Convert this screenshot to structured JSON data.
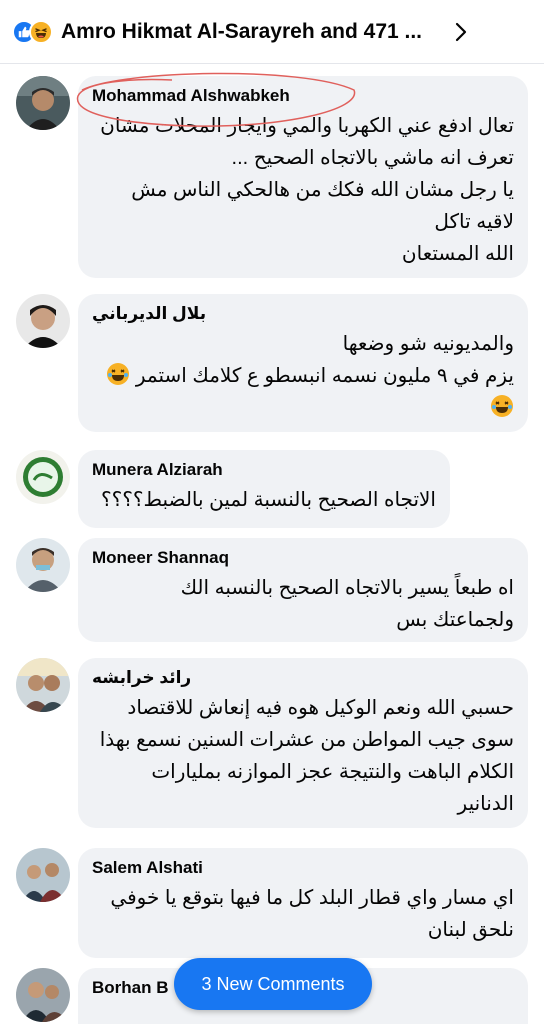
{
  "header": {
    "title": "Amro Hikmat Al-Sarayreh and 471 ...",
    "reactions": [
      "like-icon",
      "haha-icon"
    ]
  },
  "comments": [
    {
      "author": "Mohammad Alshwabkeh",
      "lines": [
        "تعال ادفع عني الكهربا والمي وايجار المحلات مشان",
        "تعرف انه ماشي بالاتجاه الصحيح ...",
        "يا رجل مشان الله فكك من هالحكي الناس مش",
        "لاقيه تاكل",
        "الله المستعان"
      ]
    },
    {
      "author": "بلال الديرباني",
      "lines": [
        "والمديونيه شو وضعها",
        "يزم في ٩ مليون نسمه انبسطو ع كلامك استمر",
        ""
      ],
      "emoji": "haha-emoji"
    },
    {
      "author": "Munera Alziarah",
      "lines": [
        "الاتجاه الصحيح بالنسبة لمين بالضبط؟؟؟؟"
      ]
    },
    {
      "author": "Moneer Shannaq",
      "lines": [
        "اه طبعاً يسير بالاتجاه الصحيح بالنسبه الك",
        "ولجماعتك بس"
      ]
    },
    {
      "author": "رائد خرابشه",
      "lines": [
        "حسبي الله ونعم الوكيل  هوه فيه إنعاش للاقتصاد",
        "سوى جيب المواطن من عشرات السنين نسمع بهذا",
        "الكلام الباهت والنتيجة عجز الموازنه بمليارات",
        "الدنانير"
      ]
    },
    {
      "author": "Salem Alshati",
      "lines": [
        "اي مسار واي قطار البلد كل ما فيها بتوقع يا خوفي",
        "نلحق لبنان"
      ]
    },
    {
      "author": "Borhan B",
      "lines": []
    }
  ],
  "new_comments_label": "3 New Comments",
  "colors": {
    "accent": "#1877f2",
    "bubble": "#f0f2f5",
    "annotation": "#e0605c"
  }
}
